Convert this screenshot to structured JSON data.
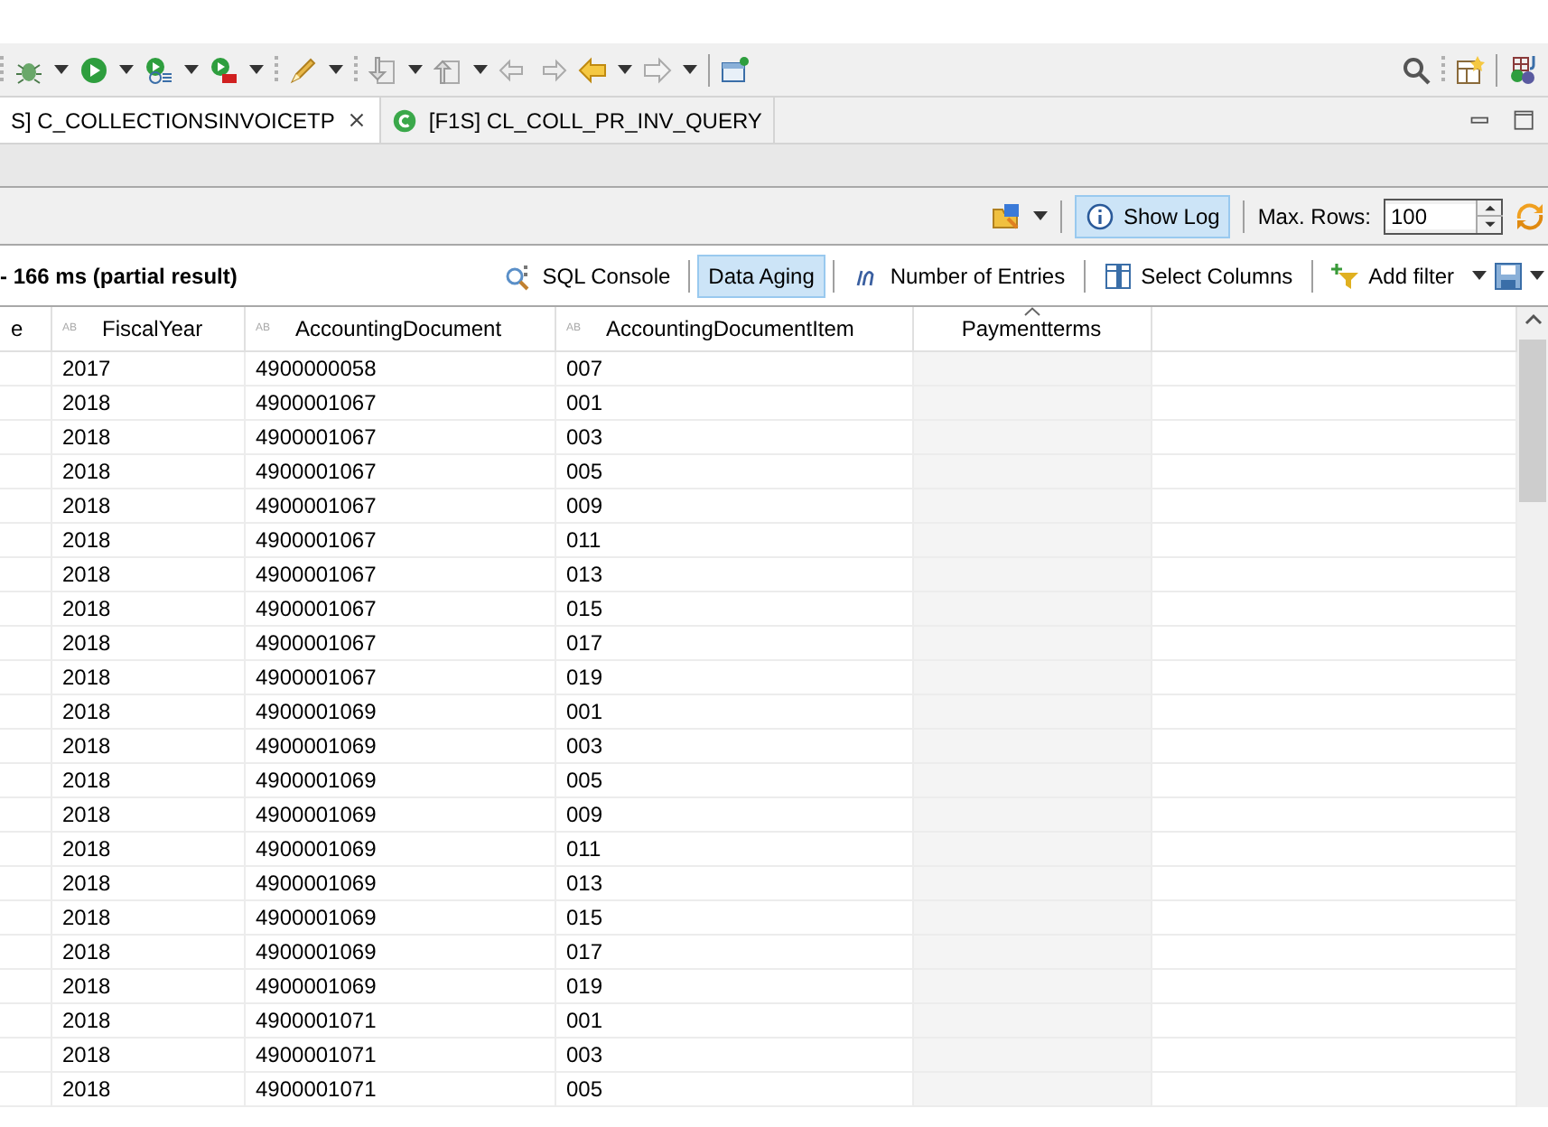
{
  "editor_tabs": [
    {
      "label": "S] C_COLLECTIONSINVOICETP",
      "selected": true,
      "closable": true
    },
    {
      "label": "[F1S] CL_COLL_PR_INV_QUERY",
      "selected": false,
      "closable": false
    }
  ],
  "log_toolbar": {
    "show_log": {
      "label": "Show Log",
      "selected": true
    },
    "max_rows_label": "Max. Rows:",
    "max_rows": "100"
  },
  "result_toolbar": {
    "status": "- 166 ms (partial result)",
    "buttons": [
      {
        "kind": "sql",
        "label": "SQL Console",
        "selected": false
      },
      {
        "kind": "aging",
        "label": "Data Aging",
        "selected": true
      },
      {
        "kind": "count",
        "label": "Number of Entries",
        "selected": false
      },
      {
        "kind": "columns",
        "label": "Select Columns",
        "selected": false
      },
      {
        "kind": "filter",
        "label": "Add filter",
        "selected": false
      }
    ]
  },
  "table": {
    "columns": [
      {
        "label": "e",
        "sorted": false
      },
      {
        "label": "FiscalYear",
        "marker": "AB",
        "sorted": false
      },
      {
        "label": "AccountingDocument",
        "marker": "AB",
        "sorted": false
      },
      {
        "label": "AccountingDocumentItem",
        "marker": "AB",
        "sorted": false
      },
      {
        "label": "Paymentterms",
        "sorted": true
      }
    ],
    "rows": [
      [
        "",
        "2017",
        "4900000058",
        "007"
      ],
      [
        "",
        "2018",
        "4900001067",
        "001"
      ],
      [
        "",
        "2018",
        "4900001067",
        "003"
      ],
      [
        "",
        "2018",
        "4900001067",
        "005"
      ],
      [
        "",
        "2018",
        "4900001067",
        "009"
      ],
      [
        "",
        "2018",
        "4900001067",
        "011"
      ],
      [
        "",
        "2018",
        "4900001067",
        "013"
      ],
      [
        "",
        "2018",
        "4900001067",
        "015"
      ],
      [
        "",
        "2018",
        "4900001067",
        "017"
      ],
      [
        "",
        "2018",
        "4900001067",
        "019"
      ],
      [
        "",
        "2018",
        "4900001069",
        "001"
      ],
      [
        "",
        "2018",
        "4900001069",
        "003"
      ],
      [
        "",
        "2018",
        "4900001069",
        "005"
      ],
      [
        "",
        "2018",
        "4900001069",
        "009"
      ],
      [
        "",
        "2018",
        "4900001069",
        "011"
      ],
      [
        "",
        "2018",
        "4900001069",
        "013"
      ],
      [
        "",
        "2018",
        "4900001069",
        "015"
      ],
      [
        "",
        "2018",
        "4900001069",
        "017"
      ],
      [
        "",
        "2018",
        "4900001069",
        "019"
      ],
      [
        "",
        "2018",
        "4900001071",
        "001"
      ],
      [
        "",
        "2018",
        "4900001071",
        "003"
      ],
      [
        "",
        "2018",
        "4900001071",
        "005"
      ]
    ]
  }
}
